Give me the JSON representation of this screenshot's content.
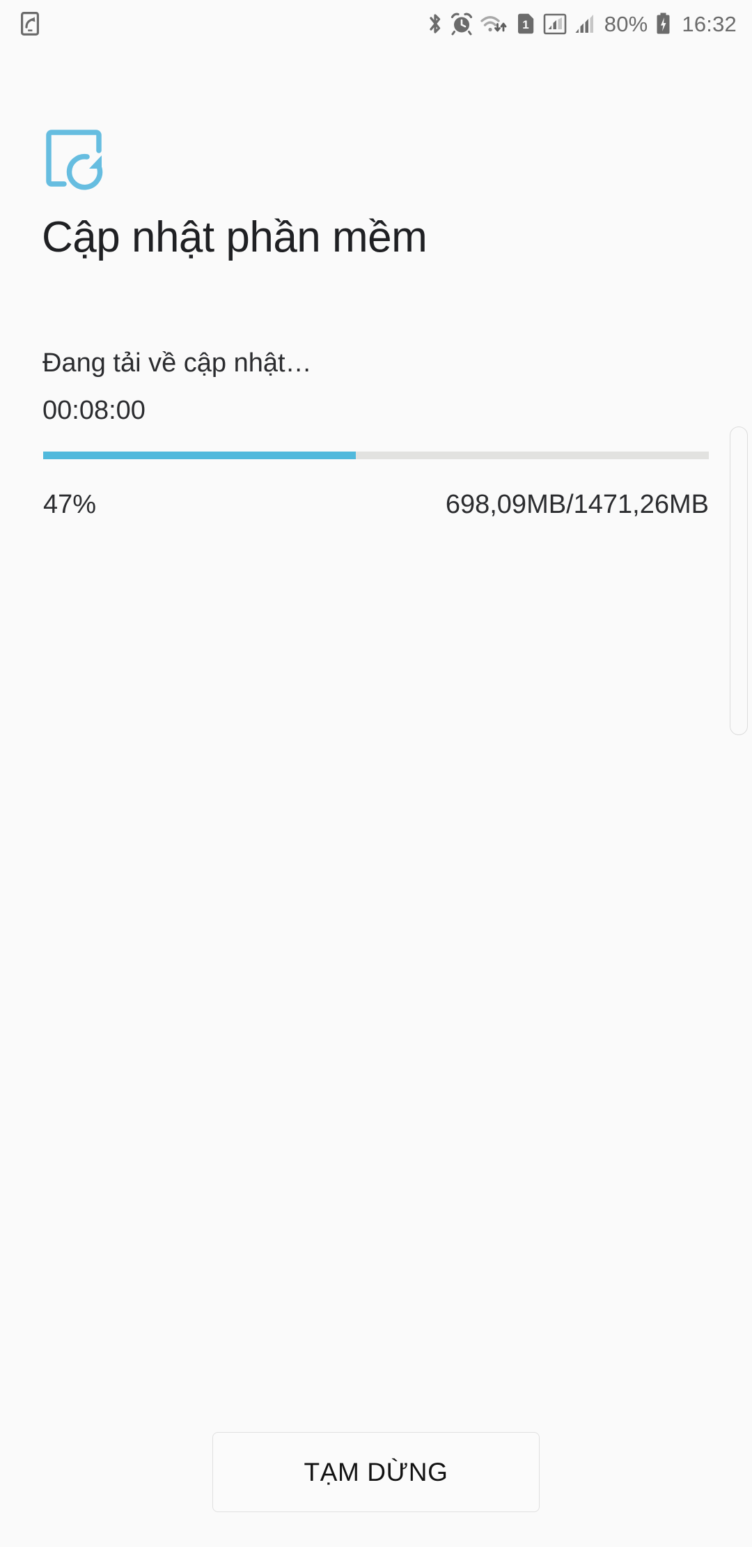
{
  "status_bar": {
    "left_icons": [
      {
        "name": "screen-recording-icon",
        "label": "device-arrow"
      }
    ],
    "right_icons": [
      {
        "name": "bluetooth-icon",
        "label": "Bluetooth"
      },
      {
        "name": "alarm-clock-icon",
        "label": "Alarm"
      },
      {
        "name": "wifi-data-transfer-icon",
        "label": "Wi-Fi"
      },
      {
        "name": "sim-1-icon",
        "label": "1"
      },
      {
        "name": "signal-boxed-icon",
        "label": "Signal 1"
      },
      {
        "name": "signal-bars-icon",
        "label": "Signal 2"
      }
    ],
    "battery_percent": "80%",
    "battery_charging_icon": "battery-charging-icon",
    "time": "16:32"
  },
  "header": {
    "icon_name": "software-update-icon",
    "title": "Cập nhật phần mềm"
  },
  "download": {
    "status_text": "Đang tải về cập nhật…",
    "elapsed": "00:08:00",
    "percent_label": "47%",
    "percent_value": 47,
    "size_label": "698,09MB/1471,26MB",
    "downloaded": "698,09MB",
    "total": "1471,26MB"
  },
  "actions": {
    "pause_label": "TẠM DỪNG"
  },
  "colors": {
    "accent": "#51b9dc",
    "track": "#e2e2e0",
    "background": "#fafafa",
    "text_primary": "#2b2c2f",
    "status_icon": "#6b6b6b"
  }
}
